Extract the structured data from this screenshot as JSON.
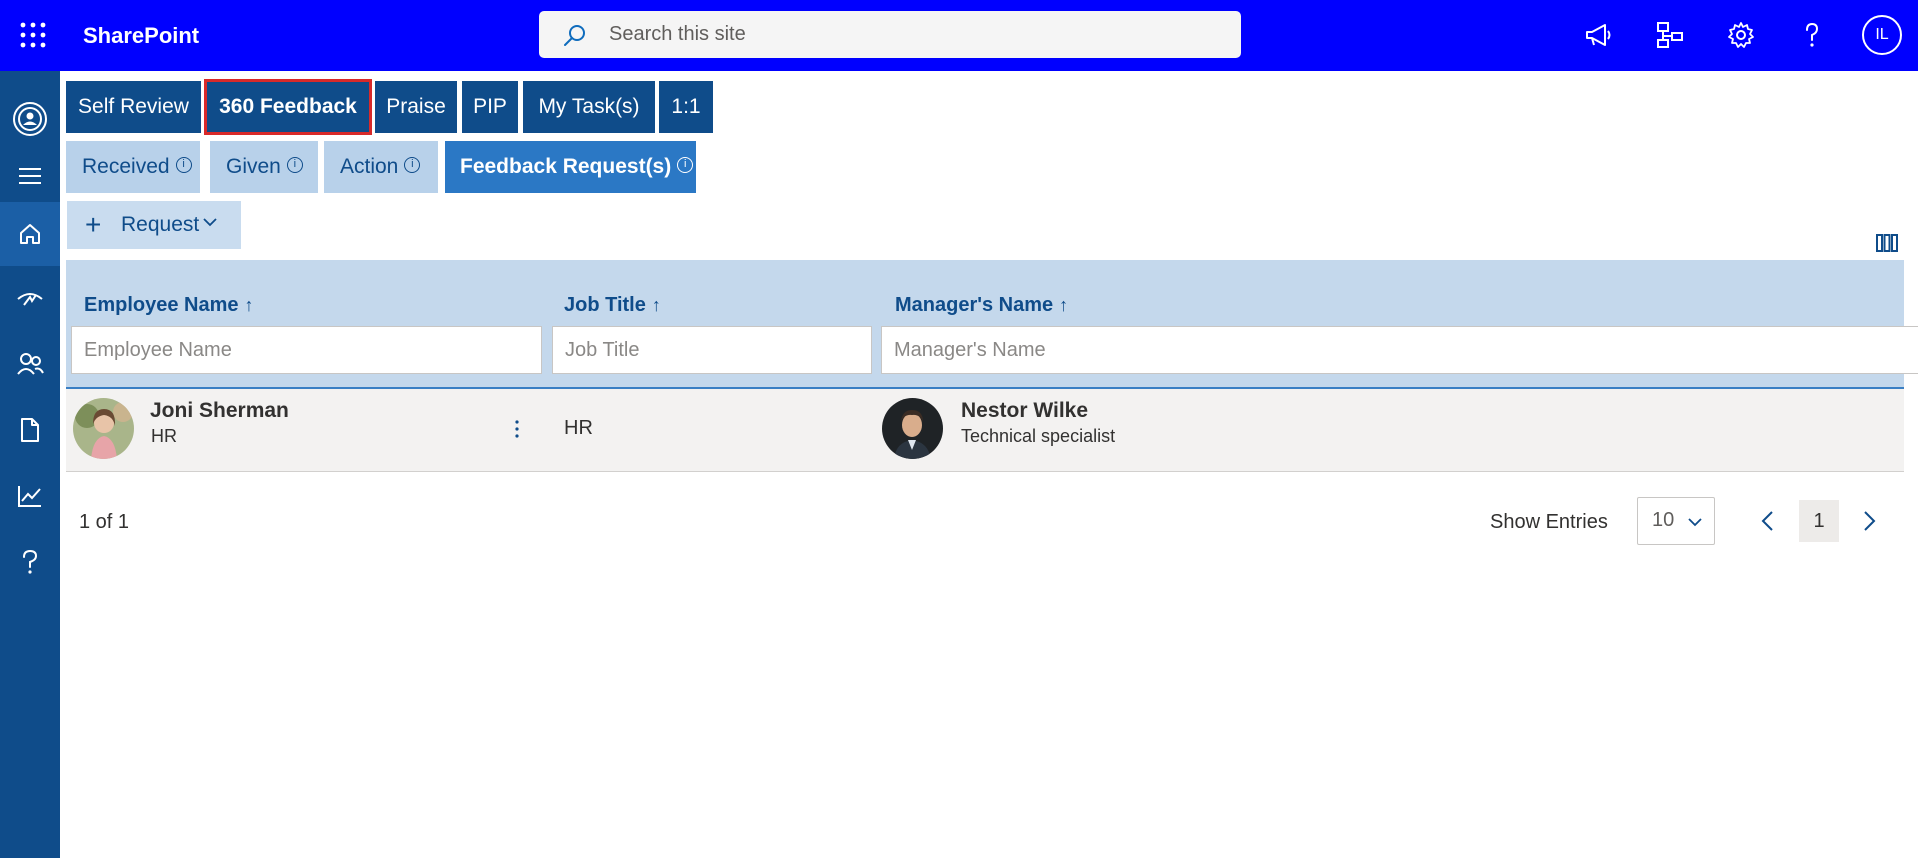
{
  "app": {
    "title": "SharePoint",
    "user_initials": "IL"
  },
  "search": {
    "placeholder": "Search this site"
  },
  "topbar_icons": [
    "megaphone-icon",
    "org-chart-icon",
    "gear-icon",
    "help-icon"
  ],
  "rail": [
    "logo-icon",
    "menu-icon",
    "home-icon",
    "performance-icon",
    "people-icon",
    "document-icon",
    "analytics-icon",
    "help-icon"
  ],
  "tabs": [
    {
      "label": "Self Review"
    },
    {
      "label": "360 Feedback",
      "selected": true
    },
    {
      "label": "Praise"
    },
    {
      "label": "PIP"
    },
    {
      "label": "My Task(s)"
    },
    {
      "label": "1:1"
    }
  ],
  "subtabs": [
    {
      "label": "Received",
      "info": "i"
    },
    {
      "label": "Given",
      "info": "i"
    },
    {
      "label": "Action",
      "info": "i"
    },
    {
      "label": "Feedback Request(s)",
      "info": "i",
      "active": true
    }
  ],
  "request_button": {
    "plus": "+",
    "label": "Request"
  },
  "table": {
    "columns": [
      {
        "label": "Employee Name",
        "arrow": "↑",
        "filter_placeholder": "Employee Name"
      },
      {
        "label": "Job Title",
        "arrow": "↑",
        "filter_placeholder": "Job Title"
      },
      {
        "label": "Manager's Name",
        "arrow": "↑",
        "filter_placeholder": "Manager's Name"
      }
    ],
    "rows": [
      {
        "employee": {
          "name": "Joni Sherman",
          "subtitle": "HR"
        },
        "job_title": "HR",
        "manager": {
          "name": "Nestor Wilke",
          "subtitle": "Technical specialist"
        }
      }
    ]
  },
  "footer": {
    "count": "1 of 1",
    "show_entries_label": "Show Entries",
    "entries_value": "10",
    "current_page": "1"
  },
  "colors": {
    "topbar": "#0000ff",
    "rail": "#0f4c8a",
    "tab": "#0f4c8a",
    "subtab": "#b8d1ea",
    "subtab_active": "#2b78c5",
    "header": "#c4d8ec",
    "selected_outline": "#d82a2a"
  }
}
